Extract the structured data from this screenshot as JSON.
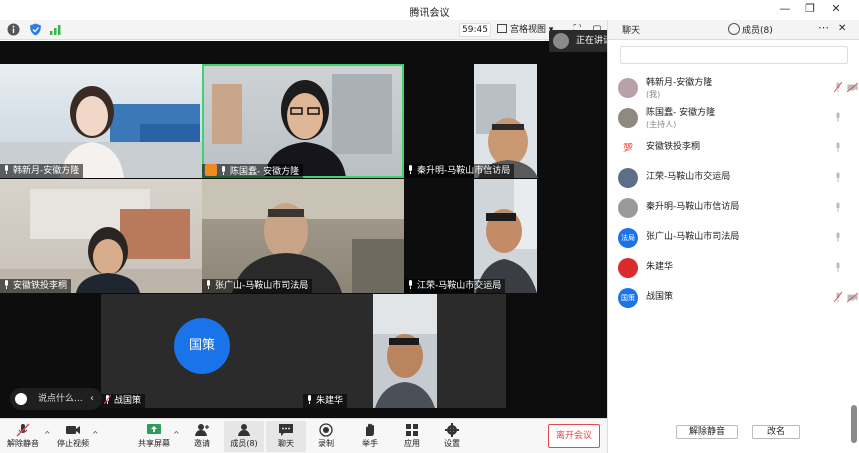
{
  "window": {
    "title": "腾讯会议"
  },
  "infobar": {
    "timer": "59:45",
    "grid_view_label": "宫格视图"
  },
  "speaking": {
    "prefix": "正在讲话: 陈国蠢- 安徽方隆; 江..."
  },
  "tiles": [
    {
      "label": "韩新月-安徽方隆"
    },
    {
      "label": "陈国蠢- 安徽方隆"
    },
    {
      "label": "秦升明-马鞍山市信访局"
    },
    {
      "label": "安徽铁投李桐"
    },
    {
      "label": "张广山-马鞍山市司法局"
    },
    {
      "label": "江荣-马鞍山市交运局"
    },
    {
      "label": "战国策",
      "avatar_text": "国策"
    },
    {
      "label": "朱建华"
    }
  ],
  "chat_mini": {
    "placeholder": "说点什么..."
  },
  "toolbar": {
    "unmute": "解除静音",
    "stop_video": "停止视频",
    "share_screen": "共享屏幕",
    "invite": "邀请",
    "members": "成员(8)",
    "chat": "聊天",
    "record": "录制",
    "raise_hand": "举手",
    "apps": "应用",
    "settings": "设置",
    "leave": "离开会议"
  },
  "panel": {
    "tab_chat": "聊天",
    "tab_members": "成员(8)",
    "members": [
      {
        "name": "韩新月-安徽方隆",
        "sub": "(我)",
        "avatar": ""
      },
      {
        "name": "陈国蠢- 安徽方隆",
        "sub": "(主持人)",
        "avatar": ""
      },
      {
        "name": "安徽铁投李桐",
        "sub": "",
        "avatar": "💯"
      },
      {
        "name": "江荣-马鞍山市交运局",
        "sub": "",
        "avatar": ""
      },
      {
        "name": "秦升明-马鞍山市信访局",
        "sub": "",
        "avatar": ""
      },
      {
        "name": "张广山-马鞍山市司法局",
        "sub": "",
        "avatar": "法局"
      },
      {
        "name": "朱建华",
        "sub": "",
        "avatar": ""
      },
      {
        "name": "战国策",
        "sub": "",
        "avatar": "国策"
      }
    ],
    "unmute_all": "解除静音",
    "rename": "改名"
  },
  "colors": {
    "accent": "#1a73e8",
    "leave": "#e5484d",
    "active_speaker": "#3dd46e"
  }
}
